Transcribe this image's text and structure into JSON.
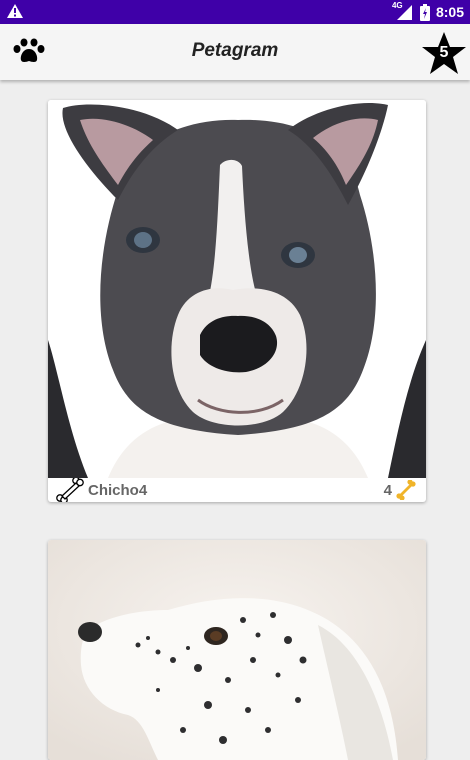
{
  "status_bar": {
    "network": "4G",
    "time": "8:05",
    "icons": [
      "warning-icon",
      "signal-icon",
      "battery-icon"
    ]
  },
  "app_bar": {
    "title": "Petagram",
    "favorites_count": "5",
    "icons": [
      "paw-icon",
      "star-icon"
    ]
  },
  "pets": [
    {
      "name": "Chicho4",
      "likes": "4"
    }
  ],
  "colors": {
    "status_bar": "#3f00a8",
    "app_bar": "#f5f5f5",
    "background": "#eeeeee",
    "bone_gold": "#f0b429"
  }
}
